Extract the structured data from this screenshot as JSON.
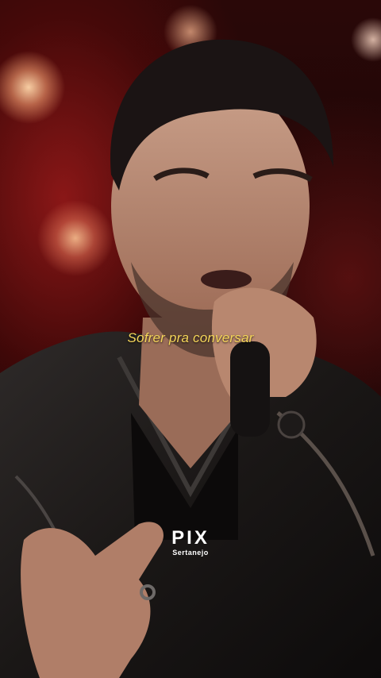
{
  "video": {
    "lyric_caption": "Sofrer pra conversar",
    "watermark": {
      "title": "PIX",
      "subtitle": "Sertanejo"
    }
  }
}
